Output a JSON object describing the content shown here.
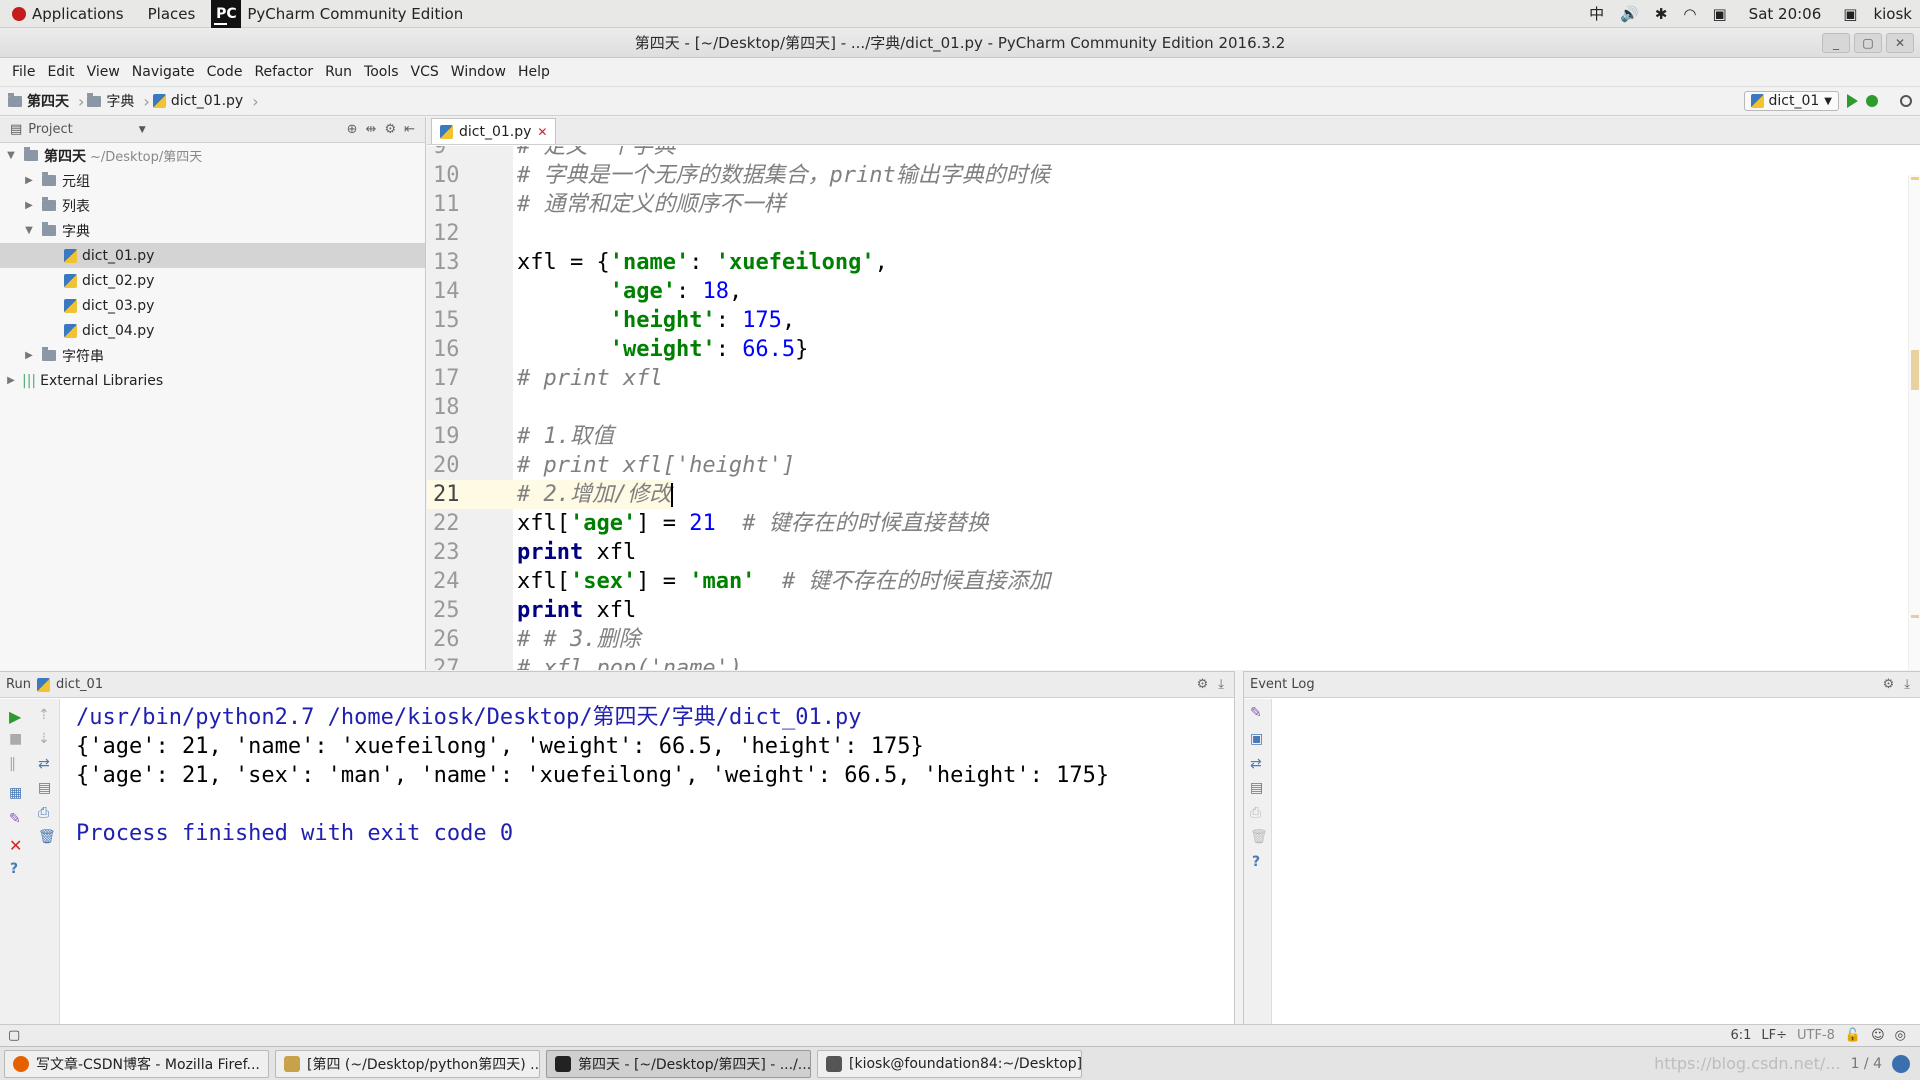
{
  "topbar": {
    "applications": "Applications",
    "places": "Places",
    "active_app": "PyCharm Community Edition",
    "input_method": "中",
    "clock": "Sat 20:06",
    "user": "kiosk"
  },
  "window": {
    "title": "第四天 - [~/Desktop/第四天] - .../字典/dict_01.py - PyCharm Community Edition 2016.3.2"
  },
  "menu": [
    "File",
    "Edit",
    "View",
    "Navigate",
    "Code",
    "Refactor",
    "Run",
    "Tools",
    "VCS",
    "Window",
    "Help"
  ],
  "breadcrumb": [
    "第四天",
    "字典",
    "dict_01.py"
  ],
  "run_config": "dict_01",
  "project": {
    "header": "Project",
    "root": "第四天",
    "root_path": "~/Desktop/第四天",
    "items": [
      {
        "label": "元组"
      },
      {
        "label": "列表"
      },
      {
        "label": "字典"
      },
      {
        "label": "dict_01.py"
      },
      {
        "label": "dict_02.py"
      },
      {
        "label": "dict_03.py"
      },
      {
        "label": "dict_04.py"
      },
      {
        "label": "字符串"
      }
    ],
    "external": "External Libraries"
  },
  "editor": {
    "tab": "dict_01.py",
    "current_line": 21,
    "lines": [
      {
        "n": "9",
        "parts": [
          {
            "t": "# 定义一个字典",
            "c": "com"
          }
        ]
      },
      {
        "n": "10",
        "parts": [
          {
            "t": "# 字典是一个无序的数据集合，print输出字典的时候",
            "c": "com"
          }
        ]
      },
      {
        "n": "11",
        "parts": [
          {
            "t": "# 通常和定义的顺序不一样",
            "c": "com"
          }
        ]
      },
      {
        "n": "12",
        "parts": []
      },
      {
        "n": "13",
        "parts": [
          {
            "t": "xfl = {",
            "c": ""
          },
          {
            "t": "'name'",
            "c": "str"
          },
          {
            "t": ": ",
            "c": ""
          },
          {
            "t": "'xuefeilong'",
            "c": "str"
          },
          {
            "t": ",",
            "c": ""
          }
        ]
      },
      {
        "n": "14",
        "parts": [
          {
            "t": "       ",
            "c": ""
          },
          {
            "t": "'age'",
            "c": "str"
          },
          {
            "t": ": ",
            "c": ""
          },
          {
            "t": "18",
            "c": "num"
          },
          {
            "t": ",",
            "c": ""
          }
        ]
      },
      {
        "n": "15",
        "parts": [
          {
            "t": "       ",
            "c": ""
          },
          {
            "t": "'height'",
            "c": "str"
          },
          {
            "t": ": ",
            "c": ""
          },
          {
            "t": "175",
            "c": "num"
          },
          {
            "t": ",",
            "c": ""
          }
        ]
      },
      {
        "n": "16",
        "parts": [
          {
            "t": "       ",
            "c": ""
          },
          {
            "t": "'weight'",
            "c": "str"
          },
          {
            "t": ": ",
            "c": ""
          },
          {
            "t": "66.5",
            "c": "num"
          },
          {
            "t": "}",
            "c": ""
          }
        ]
      },
      {
        "n": "17",
        "parts": [
          {
            "t": "# print xfl",
            "c": "com"
          }
        ]
      },
      {
        "n": "18",
        "parts": []
      },
      {
        "n": "19",
        "parts": [
          {
            "t": "# 1.取值",
            "c": "com"
          }
        ]
      },
      {
        "n": "20",
        "parts": [
          {
            "t": "# print xfl['height']",
            "c": "com"
          }
        ]
      },
      {
        "n": "21",
        "parts": [
          {
            "t": "# 2.增加/修改",
            "c": "com"
          }
        ]
      },
      {
        "n": "22",
        "parts": [
          {
            "t": "xfl[",
            "c": ""
          },
          {
            "t": "'age'",
            "c": "str"
          },
          {
            "t": "] = ",
            "c": ""
          },
          {
            "t": "21",
            "c": "num"
          },
          {
            "t": "  ",
            "c": ""
          },
          {
            "t": "# 键存在的时候直接替换",
            "c": "com"
          }
        ]
      },
      {
        "n": "23",
        "parts": [
          {
            "t": "print",
            "c": "kw"
          },
          {
            "t": " xfl",
            "c": ""
          }
        ]
      },
      {
        "n": "24",
        "parts": [
          {
            "t": "xfl[",
            "c": ""
          },
          {
            "t": "'sex'",
            "c": "str"
          },
          {
            "t": "] = ",
            "c": ""
          },
          {
            "t": "'man'",
            "c": "str"
          },
          {
            "t": "  ",
            "c": ""
          },
          {
            "t": "# 键不存在的时候直接添加",
            "c": "com"
          }
        ]
      },
      {
        "n": "25",
        "parts": [
          {
            "t": "print",
            "c": "kw"
          },
          {
            "t": " xfl",
            "c": ""
          }
        ]
      },
      {
        "n": "26",
        "parts": [
          {
            "t": "# # 3.删除",
            "c": "com"
          }
        ]
      },
      {
        "n": "27",
        "parts": [
          {
            "t": "# xfl.pop('name')",
            "c": "com"
          }
        ]
      }
    ]
  },
  "run": {
    "label": "Run",
    "config": "dict_01",
    "output": [
      {
        "t": "/usr/bin/python2.7 /home/kiosk/Desktop/第四天/字典/dict_01.py",
        "c": "blue"
      },
      {
        "t": "{'age': 21, 'name': 'xuefeilong', 'weight': 66.5, 'height': 175}",
        "c": ""
      },
      {
        "t": "{'age': 21, 'sex': 'man', 'name': 'xuefeilong', 'weight': 66.5, 'height': 175}",
        "c": ""
      },
      {
        "t": "",
        "c": ""
      },
      {
        "t": "Process finished with exit code 0",
        "c": "blue"
      }
    ]
  },
  "eventlog": {
    "label": "Event Log"
  },
  "status": {
    "position": "6:1",
    "line_sep": "LF÷",
    "encoding": "UTF-8"
  },
  "taskbar": {
    "tasks": [
      {
        "label": "写文章-CSDN博客 - Mozilla Firef...",
        "color": "#e66000"
      },
      {
        "label": "[第四 (~/Desktop/python第四天) ...",
        "color": "#c8a24a"
      },
      {
        "label": "第四天 - [~/Desktop/第四天] - .../...",
        "color": "#222222"
      },
      {
        "label": "[kiosk@foundation84:~/Desktop]",
        "color": "#555555"
      }
    ],
    "watermark": "https://blog.csdn.net/...",
    "pager": "1 / 4"
  },
  "colors": {
    "comment": "#808080",
    "string": "#008000",
    "number": "#0000ff",
    "keyword": "#000080",
    "current_line": "#fffae3"
  }
}
